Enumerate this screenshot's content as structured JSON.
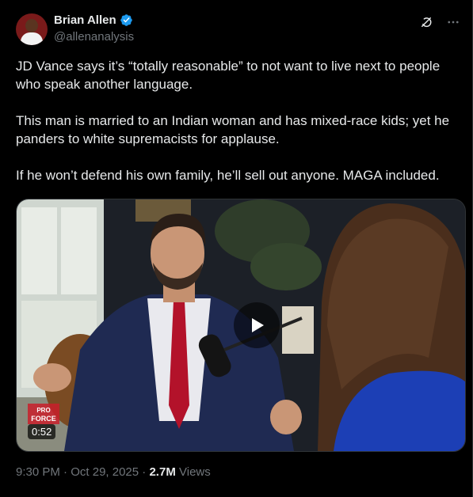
{
  "author": {
    "name": "Brian Allen",
    "handle": "@allenanalysis"
  },
  "post": {
    "paragraphs": [
      "JD Vance says it’s “totally reasonable” to not want to live next to people who speak another language.",
      "This man is married to an Indian woman and has mixed-race kids; yet he panders to white supremacists for applause.",
      "If he won’t defend his own family, he’ll sell out anyone. MAGA included."
    ]
  },
  "video": {
    "duration": "0:52",
    "logo_text_1": "PRO",
    "logo_text_2": "FORCE"
  },
  "meta": {
    "time": "9:30 PM",
    "separator": "·",
    "date": "Oct 29, 2025",
    "views_count": "2.7M",
    "views_label": "Views"
  },
  "colors": {
    "verified": "#1d9bf0",
    "secondary_text": "#71767b",
    "background": "#000000"
  },
  "icons": [
    "grok-icon",
    "more-icon",
    "verified-badge-icon",
    "play-icon"
  ]
}
